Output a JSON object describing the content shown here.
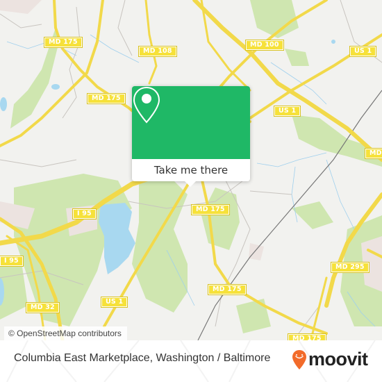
{
  "map": {
    "road_labels": [
      {
        "id": "md175-nw",
        "text": "MD 175"
      },
      {
        "id": "md108",
        "text": "MD 108"
      },
      {
        "id": "md100",
        "text": "MD 100"
      },
      {
        "id": "us1-ne",
        "text": "US 1"
      },
      {
        "id": "md175-w",
        "text": "MD 175"
      },
      {
        "id": "us1-center",
        "text": "US 1"
      },
      {
        "id": "md-east",
        "text": "MD"
      },
      {
        "id": "i95-center",
        "text": "I 95"
      },
      {
        "id": "md175-center",
        "text": "MD 175"
      },
      {
        "id": "i95-west",
        "text": "I 95"
      },
      {
        "id": "md295",
        "text": "MD 295"
      },
      {
        "id": "md175-south",
        "text": "MD 175"
      },
      {
        "id": "us1-south",
        "text": "US 1"
      },
      {
        "id": "md32",
        "text": "MD 32"
      },
      {
        "id": "md175-bottom",
        "text": "MD 175"
      }
    ],
    "attribution": "© OpenStreetMap contributors",
    "colors": {
      "background": "#f2f2ef",
      "park": "#c9e3a8",
      "water": "#a8d8f0",
      "road": "#f6e13a",
      "popup": "#1fb866",
      "brand": "#f26b2a"
    }
  },
  "popup": {
    "icon": "location-pin-icon",
    "button_label": "Take me there"
  },
  "footer": {
    "title": "Columbia East Marketplace, Washington / Baltimore",
    "brand_icon": "moovit-smile-pin-icon",
    "brand_name": "moovit"
  }
}
